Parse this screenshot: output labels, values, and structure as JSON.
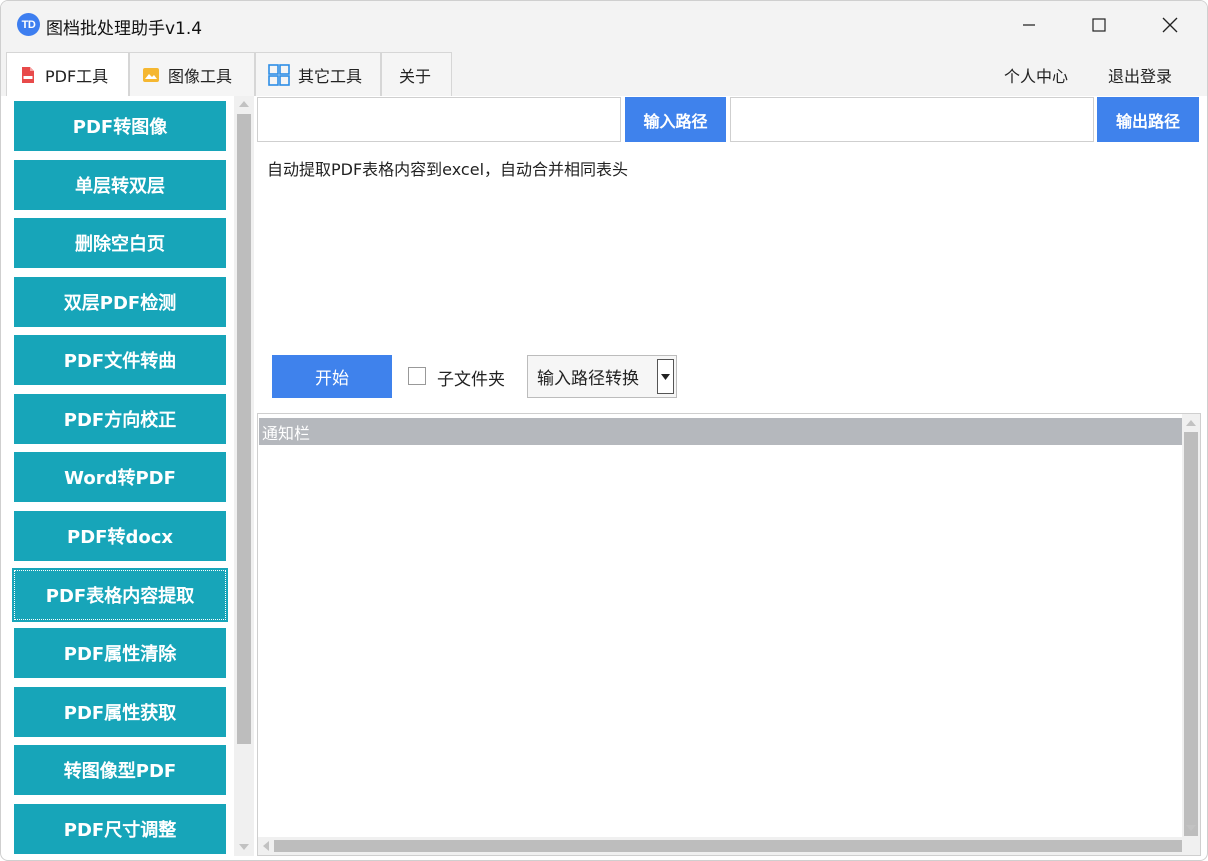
{
  "window": {
    "title": "图档批处理助手v1.4",
    "app_icon_text": "TD"
  },
  "tabs": [
    {
      "label": "PDF工具",
      "icon": "pdf-file-icon",
      "active": true
    },
    {
      "label": "图像工具",
      "icon": "image-icon",
      "active": false
    },
    {
      "label": "其它工具",
      "icon": "grid-icon",
      "active": false
    },
    {
      "label": "关于",
      "icon": "",
      "active": false
    }
  ],
  "header_links": {
    "profile": "个人中心",
    "logout": "退出登录"
  },
  "sidebar": {
    "items": [
      "PDF转图像",
      "单层转双层",
      "删除空白页",
      "双层PDF检测",
      "PDF文件转曲",
      "PDF方向校正",
      "Word转PDF",
      "PDF转docx",
      "PDF表格内容提取",
      "PDF属性清除",
      "PDF属性获取",
      "转图像型PDF",
      "PDF尺寸调整"
    ],
    "selected_index": 8
  },
  "main": {
    "input_path_value": "",
    "input_path_button": "输入路径",
    "output_path_value": "",
    "output_path_button": "输出路径",
    "description": "自动提取PDF表格内容到excel，自动合并相同表头",
    "start_button": "开始",
    "subfolder_label": "子文件夹",
    "subfolder_checked": false,
    "mode_select_value": "输入路径转换",
    "notify_header": "通知栏"
  },
  "colors": {
    "sidebar_button": "#17a5b9",
    "primary_button": "#3f82ec",
    "notify_header": "#b5b8bd"
  }
}
